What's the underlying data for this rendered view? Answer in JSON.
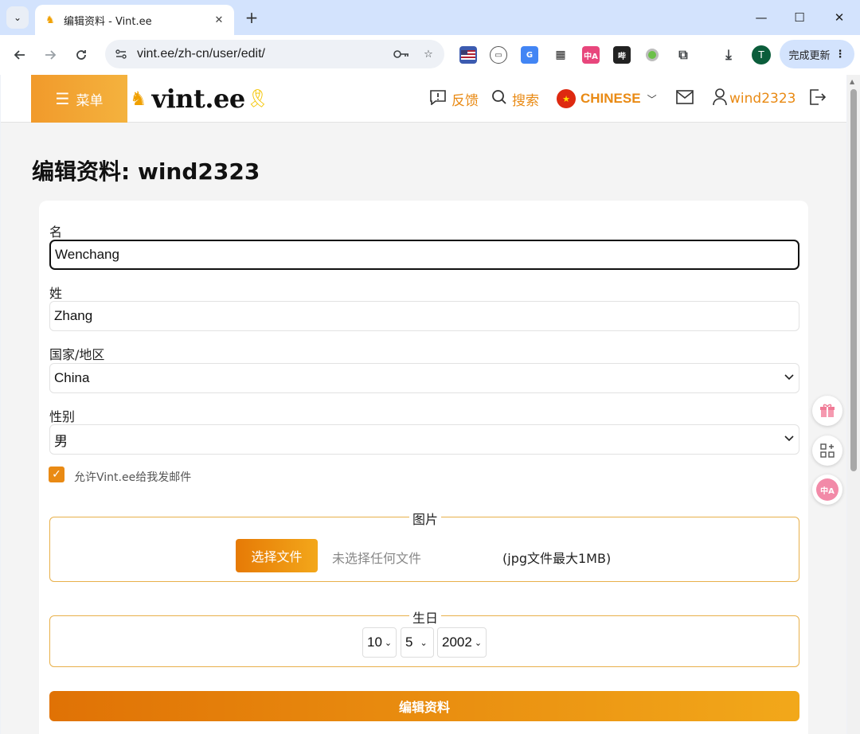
{
  "browser": {
    "tab_title": "编辑资料 - Vint.ee",
    "url": "vint.ee/zh-cn/user/edit/",
    "avatar_letter": "T",
    "update_label": "完成更新"
  },
  "header": {
    "menu_label": "菜单",
    "logo_text": "vint.ee",
    "feedback_label": "反馈",
    "search_label": "搜索",
    "language_label": "CHINESE",
    "username": "wind2323"
  },
  "page": {
    "title": "编辑资料: wind2323"
  },
  "form": {
    "first_name_label": "名",
    "first_name_value": "Wenchang",
    "last_name_label": "姓",
    "last_name_value": "Zhang",
    "country_label": "国家/地区",
    "country_value": "China",
    "gender_label": "性别",
    "gender_value": "男",
    "email_consent_label": "允许Vint.ee给我发邮件",
    "email_consent_checked": true,
    "picture_legend": "图片",
    "choose_file_label": "选择文件",
    "no_file_label": "未选择任何文件",
    "file_hint": "(jpg文件最大1MB)",
    "birthday_legend": "生日",
    "birth_month": "10",
    "birth_day": "5",
    "birth_year": "2002",
    "submit_label": "编辑资料"
  },
  "colors": {
    "accent": "#e98a14",
    "tabstrip": "#d3e3fd"
  }
}
